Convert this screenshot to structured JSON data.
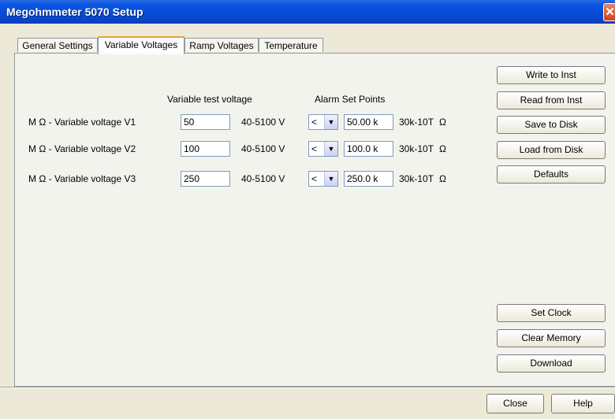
{
  "window": {
    "title": "Megohmmeter 5070 Setup",
    "close_glyph": "✕"
  },
  "tabs": [
    {
      "label": "General Settings"
    },
    {
      "label": "Variable Voltages"
    },
    {
      "label": "Ramp Voltages"
    },
    {
      "label": "Temperature"
    }
  ],
  "headers": {
    "test_voltage": "Variable test voltage",
    "alarm": "Alarm Set Points"
  },
  "rows": [
    {
      "label": "M Ω - Variable voltage  V1",
      "voltage": "50",
      "range": "40-5100 V",
      "comparator": "<",
      "alarm": "50.00 k",
      "alarm_range": "30k-10T",
      "unit": "Ω"
    },
    {
      "label": "M Ω - Variable voltage  V2",
      "voltage": "100",
      "range": "40-5100 V",
      "comparator": "<",
      "alarm": "100.0 k",
      "alarm_range": "30k-10T",
      "unit": "Ω"
    },
    {
      "label": "M Ω - Variable voltage  V3",
      "voltage": "250",
      "range": "40-5100 V",
      "comparator": "<",
      "alarm": "250.0 k",
      "alarm_range": "30k-10T",
      "unit": "Ω"
    }
  ],
  "buttons": {
    "write": "Write to Inst",
    "read": "Read from Inst",
    "save": "Save to Disk",
    "load": "Load from Disk",
    "defaults": "Defaults",
    "set_clock": "Set Clock",
    "clear_memory": "Clear Memory",
    "download": "Download",
    "close": "Close",
    "help": "Help"
  },
  "icons": {
    "dropdown_arrow": "▼"
  },
  "colors": {
    "titlebar": "#0a54e3",
    "active_tab_accent": "#e6a33a",
    "close_button": "#d2411e"
  }
}
